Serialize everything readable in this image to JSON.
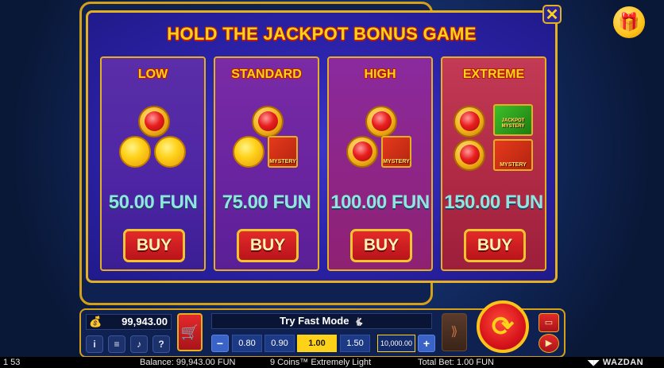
{
  "modal": {
    "title": "HOLD THE JACKPOT BONUS GAME",
    "close_glyph": "✕",
    "cards": [
      {
        "title": "LOW",
        "price": "50.00 FUN",
        "buy_label": "BUY"
      },
      {
        "title": "STANDARD",
        "price": "75.00 FUN",
        "buy_label": "BUY",
        "mystery_label": "MYSTERY"
      },
      {
        "title": "HIGH",
        "price": "100.00 FUN",
        "buy_label": "BUY",
        "mystery_label": "MYSTERY"
      },
      {
        "title": "EXTREME",
        "price": "150.00 FUN",
        "buy_label": "BUY",
        "jackpot_mystery_label": "JACKPOT MYSTERY",
        "mystery_label": "MYSTERY"
      }
    ]
  },
  "panel": {
    "balance": "99,943.00",
    "fast_mode_label": "Try Fast Mode",
    "bet_options": [
      "0.80",
      "0.90",
      "1.00",
      "1.50",
      "10,000.00"
    ],
    "selected_bet": "1.00",
    "minus_label": "−",
    "plus_label": "+"
  },
  "status": {
    "clock": "1 53",
    "balance": "Balance: 99,943.00 FUN",
    "game": "9 Coins™ Extremely Light",
    "total_bet": "Total Bet: 1.00 FUN",
    "brand": "WAZDAN"
  },
  "icons": {
    "gift": "gift-icon",
    "cart": "cart-icon",
    "spin": "spin-icon",
    "autoplay": "autoplay-icon",
    "info": "info-icon",
    "menu": "menu-icon",
    "sound": "sound-icon",
    "help": "help-icon"
  },
  "colors": {
    "accent_gold": "#ffd21a",
    "button_red": "#d8141b",
    "price_teal": "#8fe6e0"
  }
}
